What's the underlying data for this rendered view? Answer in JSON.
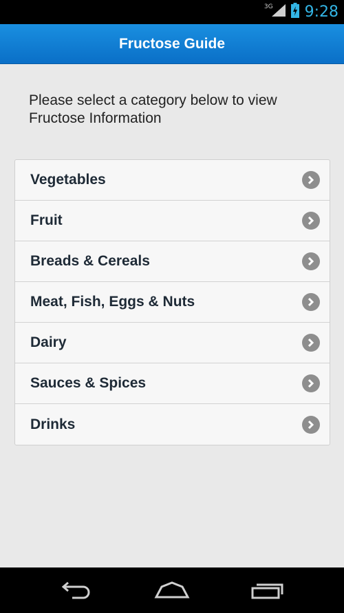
{
  "status": {
    "network": "3G",
    "time": "9:28"
  },
  "appbar": {
    "title": "Fructose Guide"
  },
  "intro": "Please select a category below to view Fructose Information",
  "categories": [
    {
      "label": "Vegetables"
    },
    {
      "label": "Fruit"
    },
    {
      "label": "Breads & Cereals"
    },
    {
      "label": "Meat, Fish, Eggs & Nuts"
    },
    {
      "label": "Dairy"
    },
    {
      "label": "Sauces & Spices"
    },
    {
      "label": "Drinks"
    }
  ],
  "colors": {
    "accent": "#33b5e5",
    "appbar": "#0a7fd6",
    "chevron": "#8e8e8e"
  },
  "icons": [
    "signal-icon",
    "battery-charging-icon",
    "chevron-right-icon",
    "back-icon",
    "home-icon",
    "recent-apps-icon"
  ]
}
